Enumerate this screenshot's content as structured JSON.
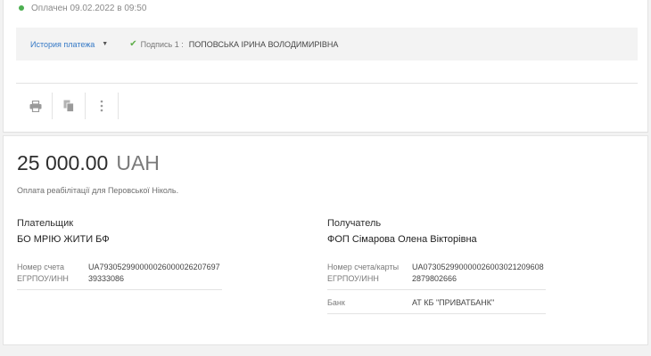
{
  "status": {
    "text": "Оплачен 09.02.2022 в 09:50",
    "color": "#4caf50"
  },
  "history": {
    "link_label": "История платежа",
    "sign_label": "Подпись 1 :",
    "signer": "ПОПОВСЬКА ІРИНА ВОЛОДИМИРІВНА"
  },
  "toolbar": {
    "print": "printer-icon",
    "copy": "copy-icon",
    "more": "more-vertical-icon"
  },
  "payment": {
    "amount": "25 000.00",
    "currency": "UAH",
    "purpose": "Оплата реабілітації для Перовської Ніколь."
  },
  "payer": {
    "role": "Плательщик",
    "name": "БО МРІЮ ЖИТИ БФ",
    "account_label": "Номер счета",
    "account": "UA793052990000026000026207697",
    "code_label": "ЕГРПОУ/ИНН",
    "code": "39333086"
  },
  "recipient": {
    "role": "Получатель",
    "name": "ФОП Сімарова Олена Вікторівна",
    "account_label": "Номер счета/карты",
    "account": "UA073052990000026003021209608",
    "code_label": "ЕГРПОУ/ИНН",
    "code": "2879802666",
    "bank_label": "Банк",
    "bank": "АТ КБ \"ПРИВАТБАНК\""
  }
}
